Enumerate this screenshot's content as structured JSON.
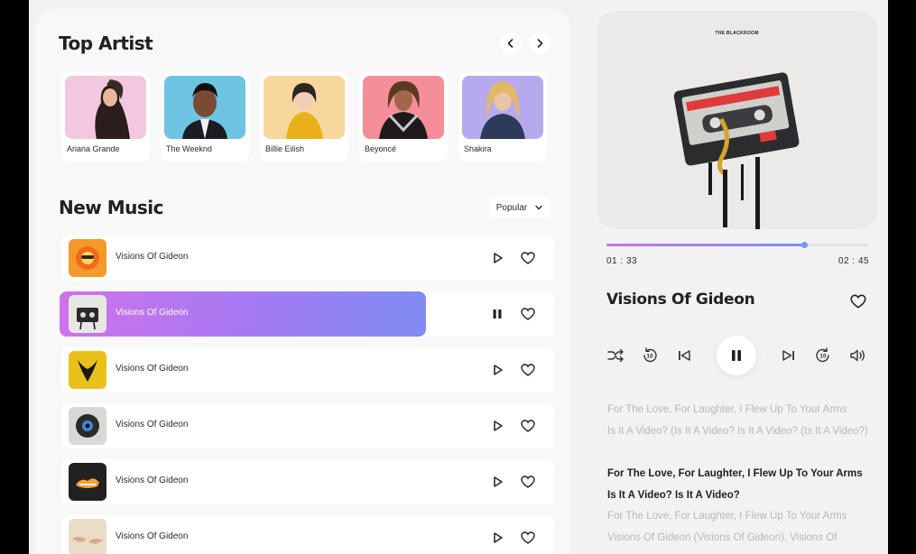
{
  "top_artist": {
    "title": "Top Artist",
    "artists": [
      {
        "name": "Ariana Grande",
        "bg": "#f4c7e1"
      },
      {
        "name": "The Weeknd",
        "bg": "#6dc4e3"
      },
      {
        "name": "Billie Eilish",
        "bg": "#f8d79e"
      },
      {
        "name": "Beyoncé",
        "bg": "#f48e98"
      },
      {
        "name": "Shakira",
        "bg": "#b7a9ee"
      }
    ]
  },
  "new_music": {
    "title": "New Music",
    "sort": "Popular",
    "tracks": [
      {
        "title": "Visions Of Gideon",
        "thumb_bg": "#f49a2a",
        "state": "play"
      },
      {
        "title": "Visions Of Gideon",
        "thumb_bg": "#e8e6e4",
        "state": "pause"
      },
      {
        "title": "Visions Of Gideon",
        "thumb_bg": "#e8c21a",
        "state": "play"
      },
      {
        "title": "Visions Of Gideon",
        "thumb_bg": "#d8d8d6",
        "state": "play"
      },
      {
        "title": "Visions Of Gideon",
        "thumb_bg": "#232120",
        "state": "play"
      },
      {
        "title": "Visions Of Gideon",
        "thumb_bg": "#e9dcc9",
        "state": "play"
      }
    ]
  },
  "player": {
    "cover_label": "THE BLACKROOM",
    "elapsed": "01 : 33",
    "duration": "02 : 45",
    "progress": 0.755,
    "title": "Visions Of Gideon",
    "lyrics": [
      {
        "text": "For The Love, For Laughter, I Flew Up To Your Arms",
        "current": false
      },
      {
        "text": "Is It A Video? (Is It A Video? Is It A Video? (Is It A Video?)",
        "current": false
      },
      {
        "text": "For The Love, For Laughter, I Flew Up To Your Arms",
        "current": true
      },
      {
        "text": "Is It A Video? Is It A Video?",
        "current": true
      },
      {
        "text": "For The Love, For Laughter, I Flew Up To Your Arms",
        "current": false
      },
      {
        "text": "Visions Of Gideon (Visions Of Gideon), Visions Of",
        "current": false
      }
    ]
  },
  "colors": {
    "accent_start": "#cf72ea",
    "accent_end": "#7f8cf2"
  }
}
